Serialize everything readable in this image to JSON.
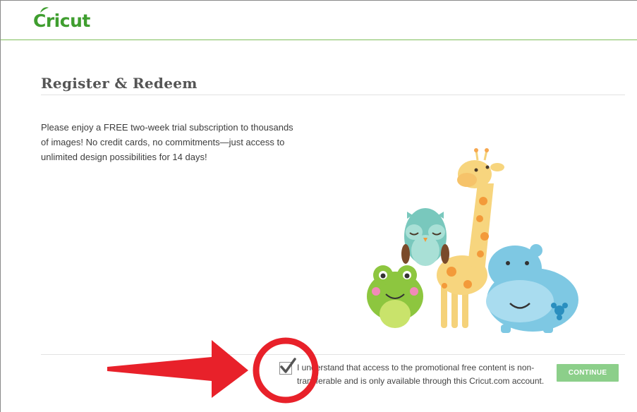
{
  "brand": {
    "logo_text": "Cricut",
    "color": "#3f9e2f"
  },
  "page": {
    "title": "Register & Redeem",
    "description": "Please enjoy a FREE two-week trial subscription to thousands of images! No credit cards, no commitments—just access to unlimited design possibilities for 14 days!"
  },
  "agreement": {
    "checked": true,
    "text": "I understand that access to the promotional free content is non-transferable and is only available through this Cricut.com account."
  },
  "actions": {
    "continue_label": "CONTINUE",
    "continue_color": "#8ccf8a"
  },
  "annotation": {
    "arrow_color": "#e8212a",
    "circle_color": "#e8212a"
  }
}
